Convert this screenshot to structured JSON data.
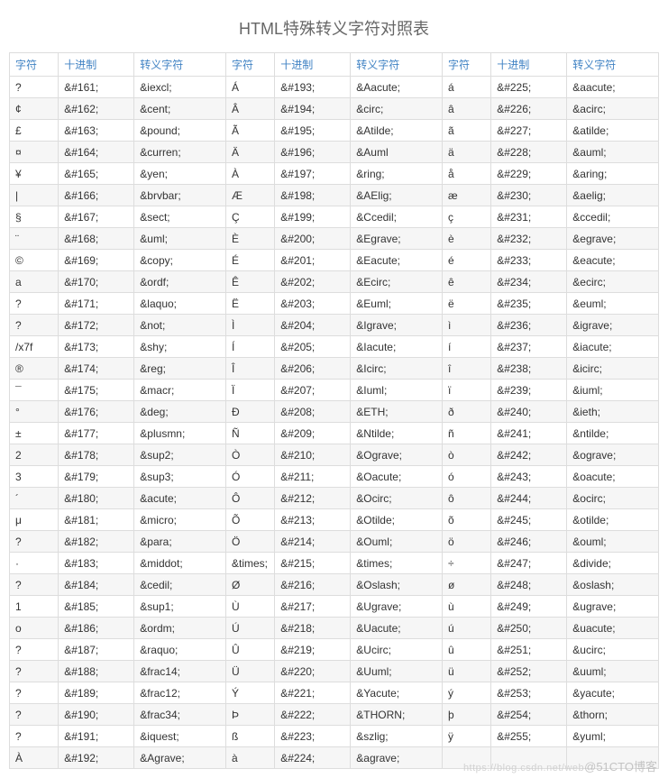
{
  "title": "HTML特殊转义字符对照表",
  "headers": [
    "字符",
    "十进制",
    "转义字符",
    "字符",
    "十进制",
    "转义字符",
    "字符",
    "十进制",
    "转义字符"
  ],
  "rows": [
    [
      "?",
      "&#161;",
      "&iexcl;",
      "Á",
      "&#193;",
      "&Aacute;",
      "á",
      "&#225;",
      "&aacute;"
    ],
    [
      "¢",
      "&#162;",
      "&cent;",
      "Â",
      "&#194;",
      "&circ;",
      "â",
      "&#226;",
      "&acirc;"
    ],
    [
      "£",
      "&#163;",
      "&pound;",
      "Ã",
      "&#195;",
      "&Atilde;",
      "ã",
      "&#227;",
      "&atilde;"
    ],
    [
      "¤",
      "&#164;",
      "&curren;",
      "Ä",
      "&#196;",
      "&Auml",
      "ä",
      "&#228;",
      "&auml;"
    ],
    [
      "¥",
      "&#165;",
      "&yen;",
      "À",
      "&#197;",
      "&ring;",
      "å",
      "&#229;",
      "&aring;"
    ],
    [
      "|",
      "&#166;",
      "&brvbar;",
      "Æ",
      "&#198;",
      "&AElig;",
      "æ",
      "&#230;",
      "&aelig;"
    ],
    [
      "§",
      "&#167;",
      "&sect;",
      "Ç",
      "&#199;",
      "&Ccedil;",
      "ç",
      "&#231;",
      "&ccedil;"
    ],
    [
      "¨",
      "&#168;",
      "&uml;",
      "È",
      "&#200;",
      "&Egrave;",
      "è",
      "&#232;",
      "&egrave;"
    ],
    [
      "©",
      "&#169;",
      "&copy;",
      "É",
      "&#201;",
      "&Eacute;",
      "é",
      "&#233;",
      "&eacute;"
    ],
    [
      "a",
      "&#170;",
      "&ordf;",
      "Ê",
      "&#202;",
      "&Ecirc;",
      "ê",
      "&#234;",
      "&ecirc;"
    ],
    [
      "?",
      "&#171;",
      "&laquo;",
      "Ë",
      "&#203;",
      "&Euml;",
      "ë",
      "&#235;",
      "&euml;"
    ],
    [
      "?",
      "&#172;",
      "&not;",
      "Ì",
      "&#204;",
      "&Igrave;",
      "ì",
      "&#236;",
      "&igrave;"
    ],
    [
      "/x7f",
      "&#173;",
      "&shy;",
      "Í",
      "&#205;",
      "&Iacute;",
      "í",
      "&#237;",
      "&iacute;"
    ],
    [
      "®",
      "&#174;",
      "&reg;",
      "Î",
      "&#206;",
      "&Icirc;",
      "î",
      "&#238;",
      "&icirc;"
    ],
    [
      "¯",
      "&#175;",
      "&macr;",
      "Ï",
      "&#207;",
      "&Iuml;",
      "ï",
      "&#239;",
      "&iuml;"
    ],
    [
      "°",
      "&#176;",
      "&deg;",
      "Ð",
      "&#208;",
      "&ETH;",
      "ð",
      "&#240;",
      "&ieth;"
    ],
    [
      "±",
      "&#177;",
      "&plusmn;",
      "Ñ",
      "&#209;",
      "&Ntilde;",
      "ñ",
      "&#241;",
      "&ntilde;"
    ],
    [
      "2",
      "&#178;",
      "&sup2;",
      "Ò",
      "&#210;",
      "&Ograve;",
      "ò",
      "&#242;",
      "&ograve;"
    ],
    [
      "3",
      "&#179;",
      "&sup3;",
      "Ó",
      "&#211;",
      "&Oacute;",
      "ó",
      "&#243;",
      "&oacute;"
    ],
    [
      "´",
      "&#180;",
      "&acute;",
      "Ô",
      "&#212;",
      "&Ocirc;",
      "ô",
      "&#244;",
      "&ocirc;"
    ],
    [
      "μ",
      "&#181;",
      "&micro;",
      "Õ",
      "&#213;",
      "&Otilde;",
      "õ",
      "&#245;",
      "&otilde;"
    ],
    [
      "?",
      "&#182;",
      "&para;",
      "Ö",
      "&#214;",
      "&Ouml;",
      "ö",
      "&#246;",
      "&ouml;"
    ],
    [
      "·",
      "&#183;",
      "&middot;",
      "&times;",
      "&#215;",
      "&times;",
      "÷",
      "&#247;",
      "&divide;"
    ],
    [
      "?",
      "&#184;",
      "&cedil;",
      "Ø",
      "&#216;",
      "&Oslash;",
      "ø",
      "&#248;",
      "&oslash;"
    ],
    [
      "1",
      "&#185;",
      "&sup1;",
      "Ù",
      "&#217;",
      "&Ugrave;",
      "ù",
      "&#249;",
      "&ugrave;"
    ],
    [
      "o",
      "&#186;",
      "&ordm;",
      "Ú",
      "&#218;",
      "&Uacute;",
      "ú",
      "&#250;",
      "&uacute;"
    ],
    [
      "?",
      "&#187;",
      "&raquo;",
      "Û",
      "&#219;",
      "&Ucirc;",
      "û",
      "&#251;",
      "&ucirc;"
    ],
    [
      "?",
      "&#188;",
      "&frac14;",
      "Ü",
      "&#220;",
      "&Uuml;",
      "ü",
      "&#252;",
      "&uuml;"
    ],
    [
      "?",
      "&#189;",
      "&frac12;",
      "Ý",
      "&#221;",
      "&Yacute;",
      "ý",
      "&#253;",
      "&yacute;"
    ],
    [
      "?",
      "&#190;",
      "&frac34;",
      "Þ",
      "&#222;",
      "&THORN;",
      "þ",
      "&#254;",
      "&thorn;"
    ],
    [
      "?",
      "&#191;",
      "&iquest;",
      "ß",
      "&#223;",
      "&szlig;",
      "ÿ",
      "&#255;",
      "&yuml;"
    ],
    [
      "À",
      "&#192;",
      "&Agrave;",
      "à",
      "&#224;",
      "&agrave;",
      "",
      "",
      ""
    ]
  ],
  "watermark": {
    "sub": "https://blog.csdn.net/web",
    "main": "@51CTO博客"
  }
}
